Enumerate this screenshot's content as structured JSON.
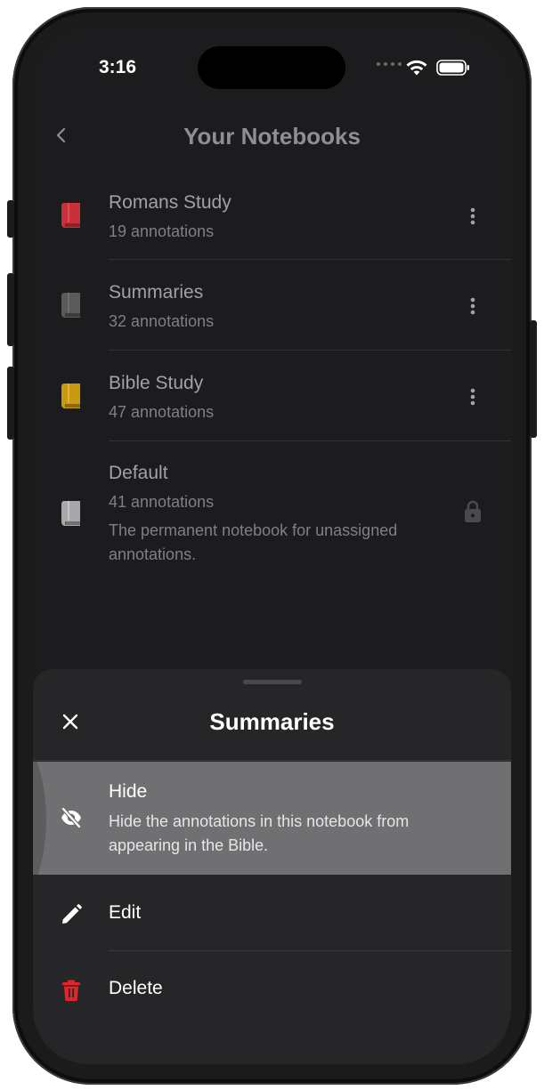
{
  "status_bar": {
    "time": "3:16"
  },
  "header": {
    "title": "Your Notebooks"
  },
  "notebooks": [
    {
      "name": "Romans Study",
      "count": "19 annotations",
      "color": "#c8303a",
      "icon": "book-icon"
    },
    {
      "name": "Summaries",
      "count": "32 annotations",
      "color": "#5a5a58",
      "icon": "book-icon"
    },
    {
      "name": "Bible Study",
      "count": "47 annotations",
      "color": "#c89a12",
      "icon": "book-icon"
    },
    {
      "name": "Default",
      "count": "41 annotations",
      "description": "The permanent notebook for unassigned annotations.",
      "color": "#a8a8aa",
      "icon": "book-icon",
      "locked": true
    }
  ],
  "sheet": {
    "title": "Summaries",
    "actions": [
      {
        "label": "Hide",
        "description": "Hide the annotations in this notebook from appearing in the Bible.",
        "icon": "eye-off-icon"
      },
      {
        "label": "Edit",
        "icon": "pencil-icon"
      },
      {
        "label": "Delete",
        "icon": "trash-icon",
        "color": "#e0262c"
      }
    ]
  }
}
